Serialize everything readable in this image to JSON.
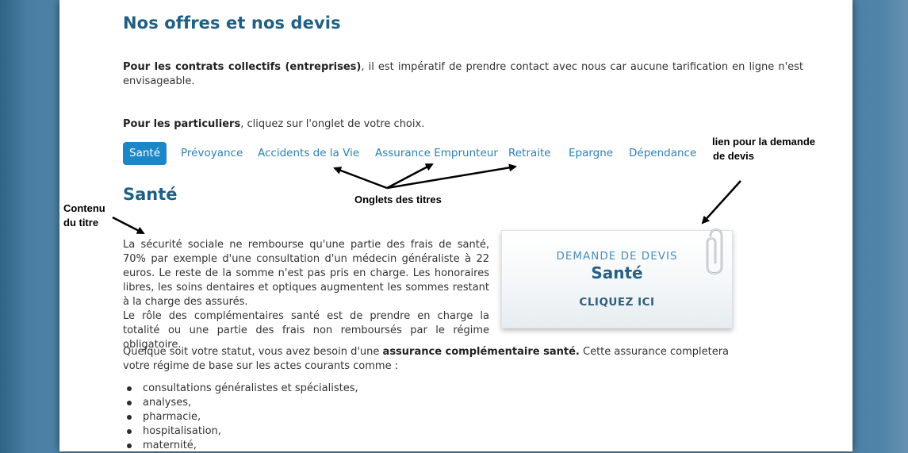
{
  "page": {
    "title": "Nos offres et nos devis"
  },
  "intro": {
    "bold": "Pour les contrats collectifs (entreprises)",
    "rest": ", il est impératif de prendre contact avec nous car aucune tarification en ligne n'est envisageable."
  },
  "particuliers": {
    "bold": "Pour les particuliers",
    "rest": ", cliquez sur l'onglet de votre choix."
  },
  "tabs": [
    {
      "label": "Santé",
      "active": true
    },
    {
      "label": "Prévoyance",
      "active": false
    },
    {
      "label": "Accidents de la Vie",
      "active": false
    },
    {
      "label": "Assurance Emprunteur",
      "active": false
    },
    {
      "label": "Retraite",
      "active": false
    },
    {
      "label": "Epargne",
      "active": false
    },
    {
      "label": "Dépendance",
      "active": false
    }
  ],
  "section": {
    "title": "Santé",
    "p1_line1": "La sécurité sociale ne rembourse qu'une partie des frais de santé, 70% par exemple d'une consultation d'un médecin généraliste à 22 euros. Le reste de la somme n'est pas pris en charge. Les honoraires libres, les soins dentaires et optiques augmentent les sommes restant à la charge des assurés.",
    "p1_line2": "Le rôle des complémentaires santé est de prendre en charge la totalité ou une partie des frais non remboursés par le régime obligatoire.",
    "p2_before": "Quelque soit votre statut, vous avez besoin d'une ",
    "p2_bold": "assurance complémentaire santé.",
    "p2_after": " Cette assurance completera votre régime de base sur les actes courants comme :",
    "bullets": [
      "consultations généralistes et spécialistes,",
      "analyses,",
      "pharmacie,",
      "hospitalisation,",
      "maternité,"
    ]
  },
  "devis_card": {
    "line1": "DEMANDE DE DEVIS",
    "line2": "Santé",
    "line3": "CLIQUEZ ICI"
  },
  "annotations": {
    "lien_line1": "lien pour la demande",
    "lien_line2": "de devis",
    "onglets": "Onglets des titres",
    "contenu_line1": "Contenu",
    "contenu_line2": "du titre"
  },
  "colors": {
    "accent": "#1b87c9",
    "tab_link": "#2a81b8",
    "heading": "#1f5f86",
    "background": "#4e82a6"
  }
}
